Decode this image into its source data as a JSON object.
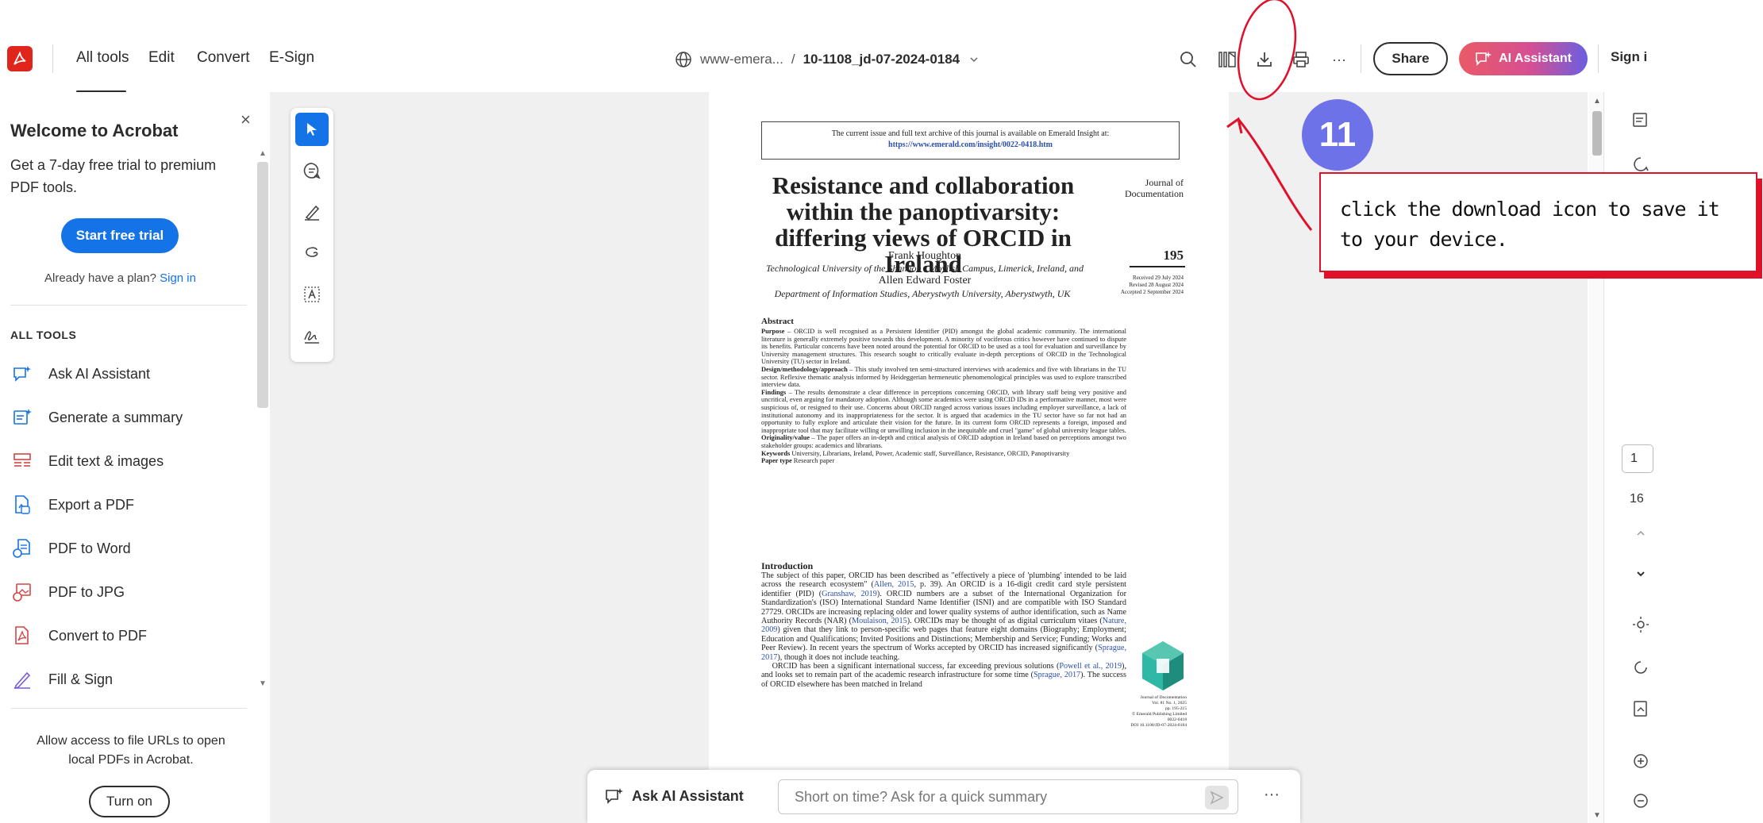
{
  "toolbar": {
    "nav": [
      "All tools",
      "Edit",
      "Convert",
      "E-Sign"
    ],
    "doc_site": "www-emera...",
    "doc_separator": "/",
    "doc_filename": "10-1108_jd-07-2024-0184",
    "share_label": "Share",
    "ai_assistant_label": "AI Assistant",
    "sign_in_label": "Sign i",
    "more_label": "···"
  },
  "left_panel": {
    "welcome_title": "Welcome to Acrobat",
    "close_label": "×",
    "trial_text": "Get a 7-day free trial to premium PDF tools.",
    "start_trial_label": "Start free trial",
    "already_text": "Already have a plan?",
    "sign_in_link": "Sign in",
    "all_tools_heading": "ALL TOOLS",
    "tools": [
      {
        "label": "Ask AI Assistant",
        "icon": "ai-assistant-icon"
      },
      {
        "label": "Generate a summary",
        "icon": "summary-icon"
      },
      {
        "label": "Edit text & images",
        "icon": "edit-text-icon"
      },
      {
        "label": "Export a PDF",
        "icon": "export-pdf-icon"
      },
      {
        "label": "PDF to Word",
        "icon": "pdf-to-word-icon"
      },
      {
        "label": "PDF to JPG",
        "icon": "pdf-to-jpg-icon"
      },
      {
        "label": "Convert to PDF",
        "icon": "convert-pdf-icon"
      },
      {
        "label": "Fill & Sign",
        "icon": "fill-sign-icon"
      }
    ],
    "allow_text": "Allow access to file URLs to open local PDFs in Acrobat.",
    "turn_on_label": "Turn on"
  },
  "pdf": {
    "notice_line": "The current issue and full text archive of this journal is available on Emerald Insight at:",
    "notice_url": "https://www.emerald.com/insight/0022-0418.htm",
    "title": "Resistance and collaboration within the panoptivarsity: differing views of ORCID in Ireland",
    "journal": "Journal of Documentation",
    "page_number": "195",
    "author1": "Frank Houghton",
    "affil1": "Technological University of the Shannon - Moylish Campus, Limerick, Ireland, and",
    "author2": "Allen Edward Foster",
    "affil2": "Department of Information Studies, Aberystwyth University, Aberystwyth, UK",
    "received": "Received 29 July 2024",
    "revised": "Revised 28 August 2024",
    "accepted": "Accepted 2 September 2024",
    "abstract_heading": "Abstract",
    "purpose_label": "Purpose",
    "purpose_text": " – ORCID is well recognised as a Persistent Identifier (PID) amongst the global academic community. The international literature is generally extremely positive towards this development. A minority of vociferous critics however have continued to dispute its benefits. Particular concerns have been noted around the potential for ORCID to be used as a tool for evaluation and surveillance by University management structures. This research sought to critically evaluate in-depth perceptions of ORCID in the Technological University (TU) sector in Ireland.",
    "design_label": "Design/methodology/approach",
    "design_text": " – This study involved ten semi-structured interviews with academics and five with librarians in the TU sector. Reflexive thematic analysis informed by Heideggerian hermeneutic phenomenological principles was used to explore transcribed interview data.",
    "findings_label": "Findings",
    "findings_text": " – The results demonstrate a clear difference in perceptions concerning ORCID, with library staff being very positive and uncritical, even arguing for mandatory adoption. Although some academics were using ORCID IDs in a performative manner, most were suspicious of, or resigned to their use. Concerns about ORCID ranged across various issues including employer surveillance, a lack of institutional autonomy and its inappropriateness for the sector. It is argued that academics in the TU sector have so far not had an opportunity to fully explore and articulate their vision for the future. In its current form ORCID represents a foreign, imposed and inappropriate tool that may facilitate willing or unwilling inclusion in the inequitable and cruel \"game\" of global university league tables.",
    "orig_label": "Originality/value",
    "orig_text": " – The paper offers an in-depth and critical analysis of ORCID adoption in Ireland based on perceptions amongst two stakeholder groups: academics and librarians.",
    "keywords_label": "Keywords",
    "keywords_text": " University, Librarians, Ireland, Power, Academic staff, Surveillance, Resistance, ORCID, Panoptivarsity",
    "ptype_label": "Paper type",
    "ptype_text": " Research paper",
    "intro_heading": "Introduction",
    "intro_p1a": "The subject of this paper, ORCID has been described as \"effectively a piece of 'plumbing' intended to be laid across the research ecosystem\" (",
    "intro_ref1": "Allen, 2015",
    "intro_p1b": ", p. 39). An ORCID is a 16-digit credit card style persistent identifier (PID) (",
    "intro_ref2": "Granshaw, 2019",
    "intro_p1c": "). ORCID numbers are a subset of the International Organization for Standardization's (ISO) International Standard Name Identifier (ISNI) and are compatible with ISO Standard 27729. ORCIDs are increasing replacing older and lower quality systems of author identification, such as Name Authority Records (NAR) (",
    "intro_ref3": "Moulaison, 2015",
    "intro_p1d": "). ORCIDs may be thought of as digital curriculum vitaes (",
    "intro_ref4": "Nature, 2009",
    "intro_p1e": ") given that they link to person-specific web pages that feature eight domains (Biography; Employment; Education and Qualifications; Invited Positions and Distinctions; Membership and Service; Funding; Works and Peer Review). In recent years the spectrum of Works accepted by ORCID has increased significantly (",
    "intro_ref5": "Sprague, 2017",
    "intro_p1f": "), though it does not include teaching.",
    "intro_p2a": "ORCID has been a significant international success, far exceeding previous solutions (",
    "intro_ref6": "Powell et al., 2019",
    "intro_p2b": "), and looks set to remain part of the academic research infrastructure for some time (",
    "intro_ref7": "Sprague, 2017",
    "intro_p2c": "). The success of ORCID elsewhere has been matched in Ireland",
    "cite_journal": "Journal of Documentation",
    "cite_vol": "Vol. 81 No. 1, 2025",
    "cite_pages": "pp. 195-215",
    "cite_publisher": "© Emerald Publishing Limited",
    "cite_issn": "0022-0418",
    "cite_doi": "DOI 10.1108/JD-07-2024-0184"
  },
  "annotation": {
    "step_number": "11",
    "callout_text": "click the download icon to save it to your device."
  },
  "ai_bar": {
    "label": "Ask AI Assistant",
    "placeholder": "Short on time? Ask for a quick summary",
    "more_label": "···"
  },
  "right_rail": {
    "page_current": "1",
    "page_total": "16"
  },
  "colors": {
    "brand_red": "#e0261c",
    "primary_blue": "#1473e6",
    "annotation_red": "#e0102a",
    "step_badge": "#6e72e8"
  }
}
